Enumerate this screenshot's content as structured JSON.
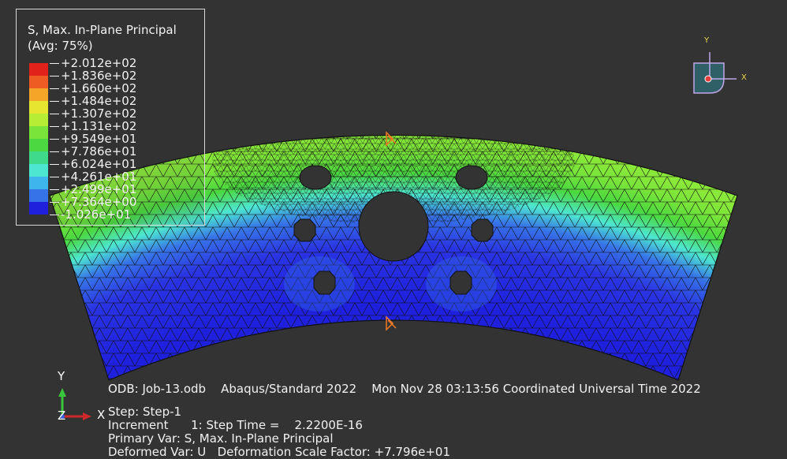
{
  "legend": {
    "title_line1": "S, Max. In-Plane Principal",
    "title_line2": "(Avg: 75%)",
    "values": [
      "+2.012e+02",
      "+1.836e+02",
      "+1.660e+02",
      "+1.484e+02",
      "+1.307e+02",
      "+1.131e+02",
      "+9.549e+01",
      "+7.786e+01",
      "+6.024e+01",
      "+4.261e+01",
      "+2.499e+01",
      "+7.364e+00",
      "-1.026e+01"
    ],
    "colors": [
      "#e0221b",
      "#ee5c24",
      "#f3a628",
      "#e7e52f",
      "#b7ee35",
      "#7ae43a",
      "#4bd840",
      "#3fdb8b",
      "#4de6d0",
      "#3fb5ee",
      "#3773e8",
      "#1e20de"
    ]
  },
  "info": {
    "line1": "ODB: Job-13.odb    Abaqus/Standard 2022    Mon Nov 28 03:13:56 Coordinated Universal Time 2022",
    "line2": "Step: Step-1",
    "line3": "Increment      1: Step Time =    2.2200E-16",
    "line4": "Primary Var: S, Max. In-Plane Principal",
    "line5": "Deformed Var: U   Deformation Scale Factor: +7.796e+01"
  },
  "triad": {
    "y": "Y",
    "z": "Z",
    "x": "X"
  },
  "view_cube": {
    "y": "Y",
    "x": "X"
  }
}
